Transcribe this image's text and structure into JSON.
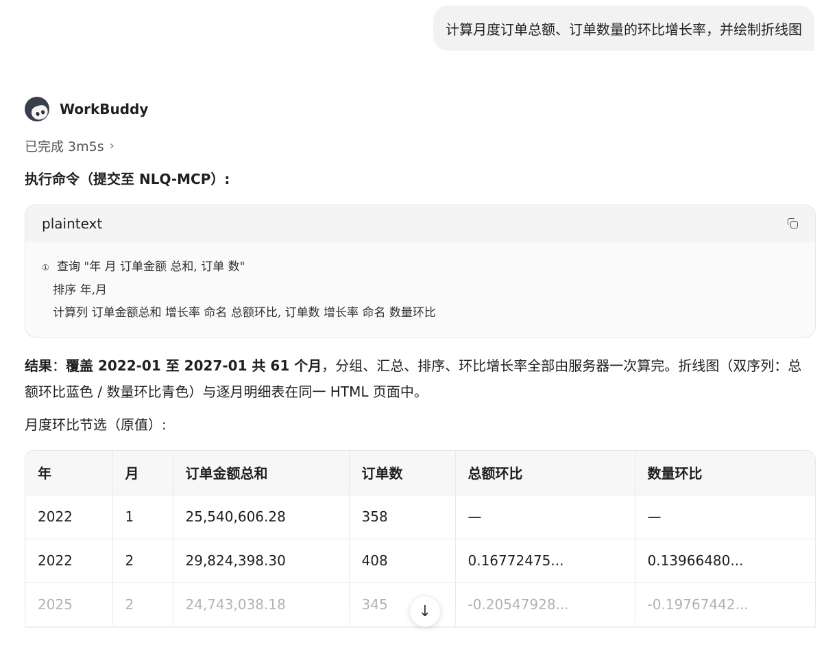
{
  "user_message": "计算月度订单总额、订单数量的环比增长率，并绘制折线图",
  "assistant": {
    "name": "WorkBuddy",
    "status": "已完成 3m5s",
    "status_chevron": "›",
    "exec_title": "执行命令（提交至 NLQ-MCP）:",
    "code": {
      "language": "plaintext",
      "marker": "①",
      "line1": "查询 \"年 月 订单金额 总和, 订单 数\"",
      "line2": "排序 年,月",
      "line3": "计算列 订单金额总和 增长率 命名 总额环比, 订单数 增长率 命名 数量环比"
    },
    "result": {
      "label": "结果",
      "colon": "：",
      "bold_part": "覆盖 2022-01 至 2027-01 共 61 个月",
      "rest": "，分组、汇总、排序、环比增长率全部由服务器一次算完。折线图（双序列：总额环比蓝色 / 数量环比青色）与逐月明细表在同一 HTML 页面中。"
    },
    "sub_title": "月度环比节选（原值）:",
    "table": {
      "headers": [
        "年",
        "月",
        "订单金额总和",
        "订单数",
        "总额环比",
        "数量环比"
      ],
      "rows": [
        [
          "2022",
          "1",
          "25,540,606.28",
          "358",
          "—",
          "—"
        ],
        [
          "2022",
          "2",
          "29,824,398.30",
          "408",
          "0.16772475...",
          "0.13966480..."
        ],
        [
          "2025",
          "2",
          "24,743,038.18",
          "345",
          "-0.20547928...",
          "-0.19767442..."
        ]
      ]
    }
  },
  "scroll_button_icon": "arrow-down-icon",
  "scroll_button_glyph": "↓"
}
